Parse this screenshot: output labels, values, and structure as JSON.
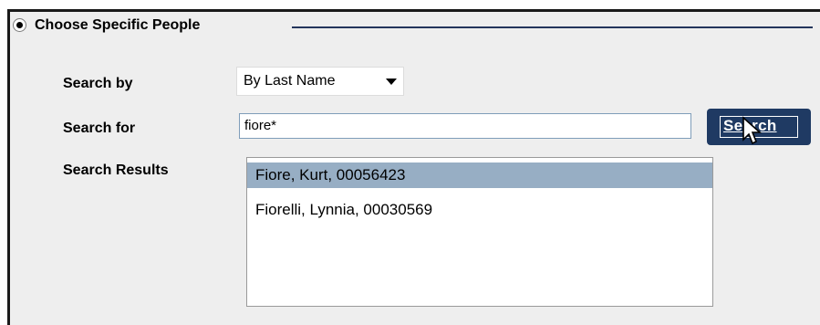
{
  "section": {
    "title": "Choose Specific People",
    "radio_selected": true
  },
  "form": {
    "search_by_label": "Search by",
    "search_by_value": "By Last Name",
    "search_for_label": "Search for",
    "search_for_value": "fiore*",
    "search_button_label": "Search",
    "results_label": "Search Results",
    "results": [
      {
        "text": "Fiore, Kurt, 00056423",
        "selected": true
      },
      {
        "text": "Fiorelli, Lynnia, 00030569",
        "selected": false
      }
    ]
  },
  "colors": {
    "panel_bg": "#eeeeee",
    "button_bg": "#1f3a63",
    "selection_bg": "#97aec4"
  },
  "icons": {
    "dropdown": "chevron-down-icon",
    "cursor": "mouse-pointer-icon"
  }
}
